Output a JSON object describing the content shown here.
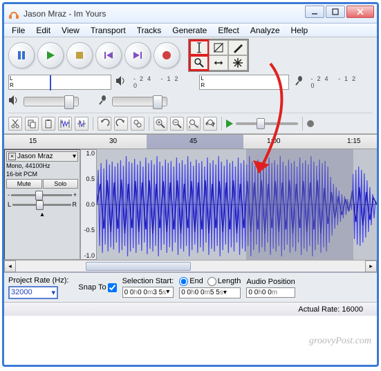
{
  "window": {
    "title": "Jason Mraz - Im Yours"
  },
  "menu": {
    "items": [
      "File",
      "Edit",
      "View",
      "Transport",
      "Tracks",
      "Generate",
      "Effect",
      "Analyze",
      "Help"
    ]
  },
  "meter": {
    "ticks": [
      "-24",
      "-12",
      "0"
    ]
  },
  "ruler": {
    "labels": [
      "15",
      "30",
      "45",
      "1:00",
      "1:15"
    ]
  },
  "track": {
    "name": "Jason Mraz",
    "format": "Mono, 44100Hz",
    "bitdepth": "16-bit PCM",
    "mute": "Mute",
    "solo": "Solo",
    "lr_left": "L",
    "lr_right": "R",
    "scale": [
      "1.0",
      "0.5",
      "0.0",
      "-0.5",
      "-1.0"
    ]
  },
  "selbar": {
    "projectRateLabel": "Project Rate (Hz):",
    "projectRate": "32000",
    "snapTo": "Snap To",
    "startLabel": "Selection Start:",
    "endLabel": "End",
    "lengthLabel": "Length",
    "audioPosLabel": "Audio Position",
    "startVal": {
      "h": "0 0",
      "m": "0 0",
      "s": "3 5"
    },
    "endVal": {
      "h": "0 0",
      "m": "0 0",
      "s": "5 5"
    },
    "posVal": {
      "h": "0 0",
      "m": "0 0"
    }
  },
  "status": {
    "rateLabel": "Actual Rate:",
    "rateVal": "16000"
  },
  "watermark": "groovyPost.com",
  "icons": {
    "selection": "I",
    "envelope": "◣",
    "draw": "✎",
    "zoom": "🔍",
    "timeshift": "↔",
    "multi": "✱"
  },
  "colors": {
    "highlight": "#e02020",
    "waveform": "#3a3ad8",
    "waveformDark": "#2020a0"
  }
}
